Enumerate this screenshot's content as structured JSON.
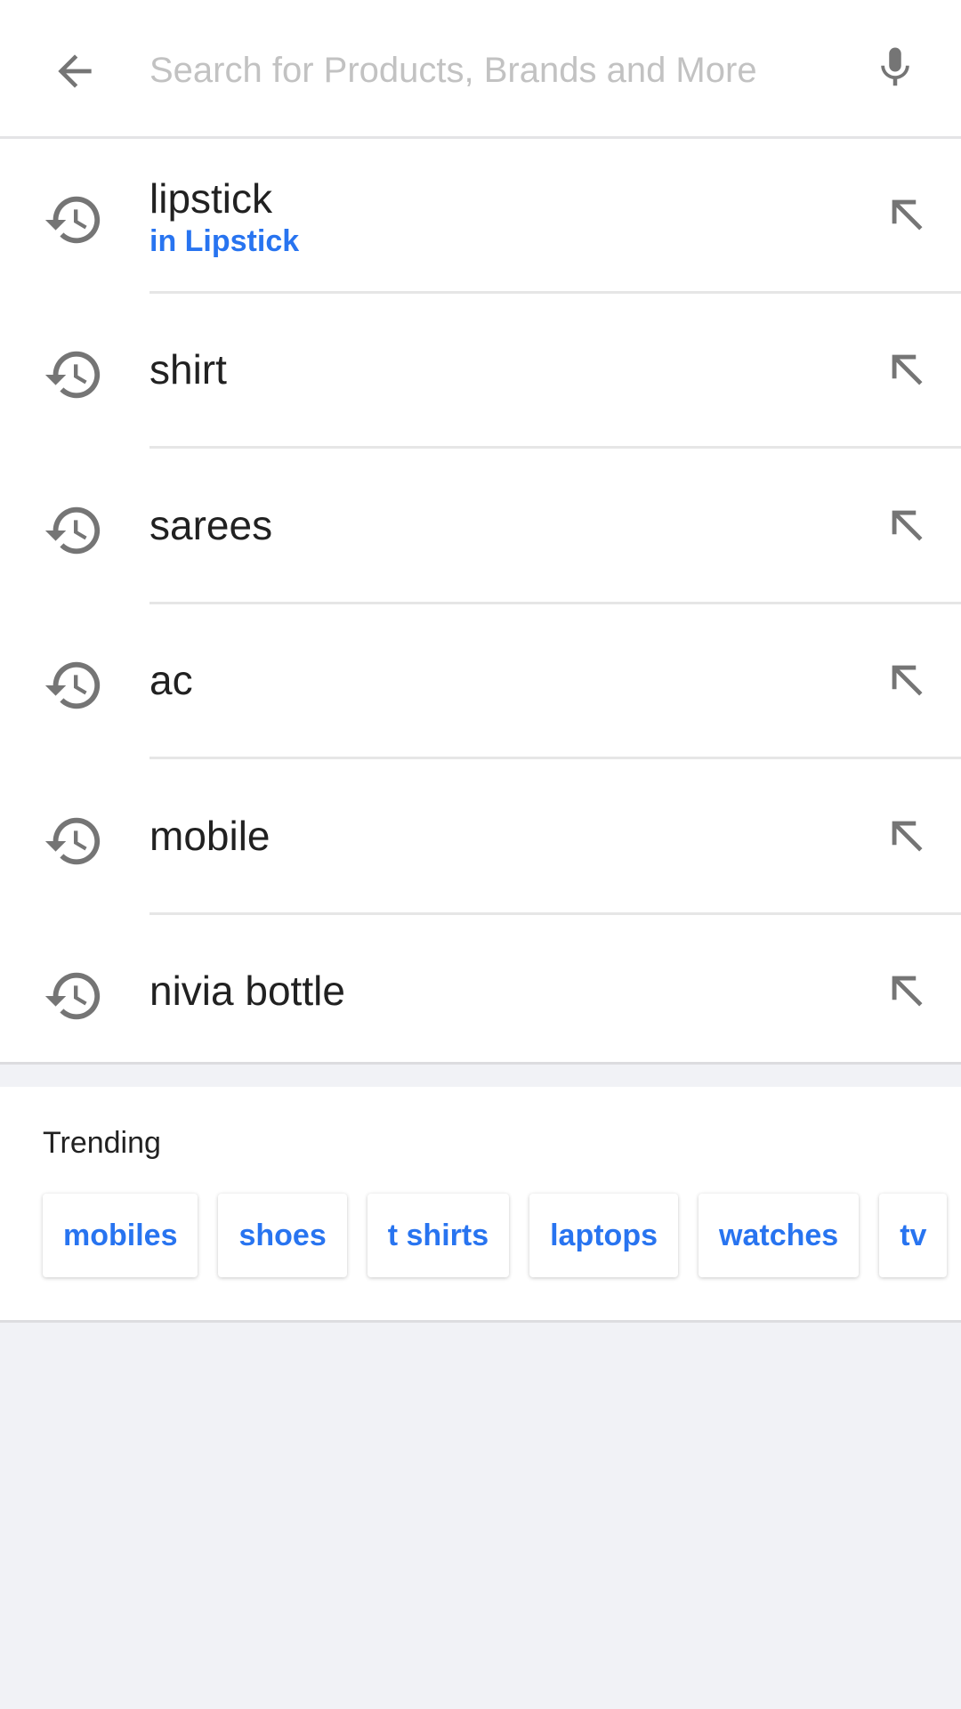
{
  "search": {
    "placeholder": "Search for Products, Brands and More",
    "value": ""
  },
  "icons": {
    "back": "arrow-back-icon",
    "mic": "microphone-icon",
    "history": "history-clock-icon",
    "fill": "arrow-up-left-icon"
  },
  "colors": {
    "accent": "#2874f0",
    "background": "#f1f2f6",
    "icon": "#757575"
  },
  "history": [
    {
      "label": "lipstick",
      "sub": "in Lipstick"
    },
    {
      "label": "shirt"
    },
    {
      "label": "sarees"
    },
    {
      "label": "ac"
    },
    {
      "label": "mobile"
    },
    {
      "label": "nivia bottle"
    }
  ],
  "trending": {
    "title": "Trending",
    "items": [
      "mobiles",
      "shoes",
      "t shirts",
      "laptops",
      "watches",
      "tv"
    ]
  }
}
